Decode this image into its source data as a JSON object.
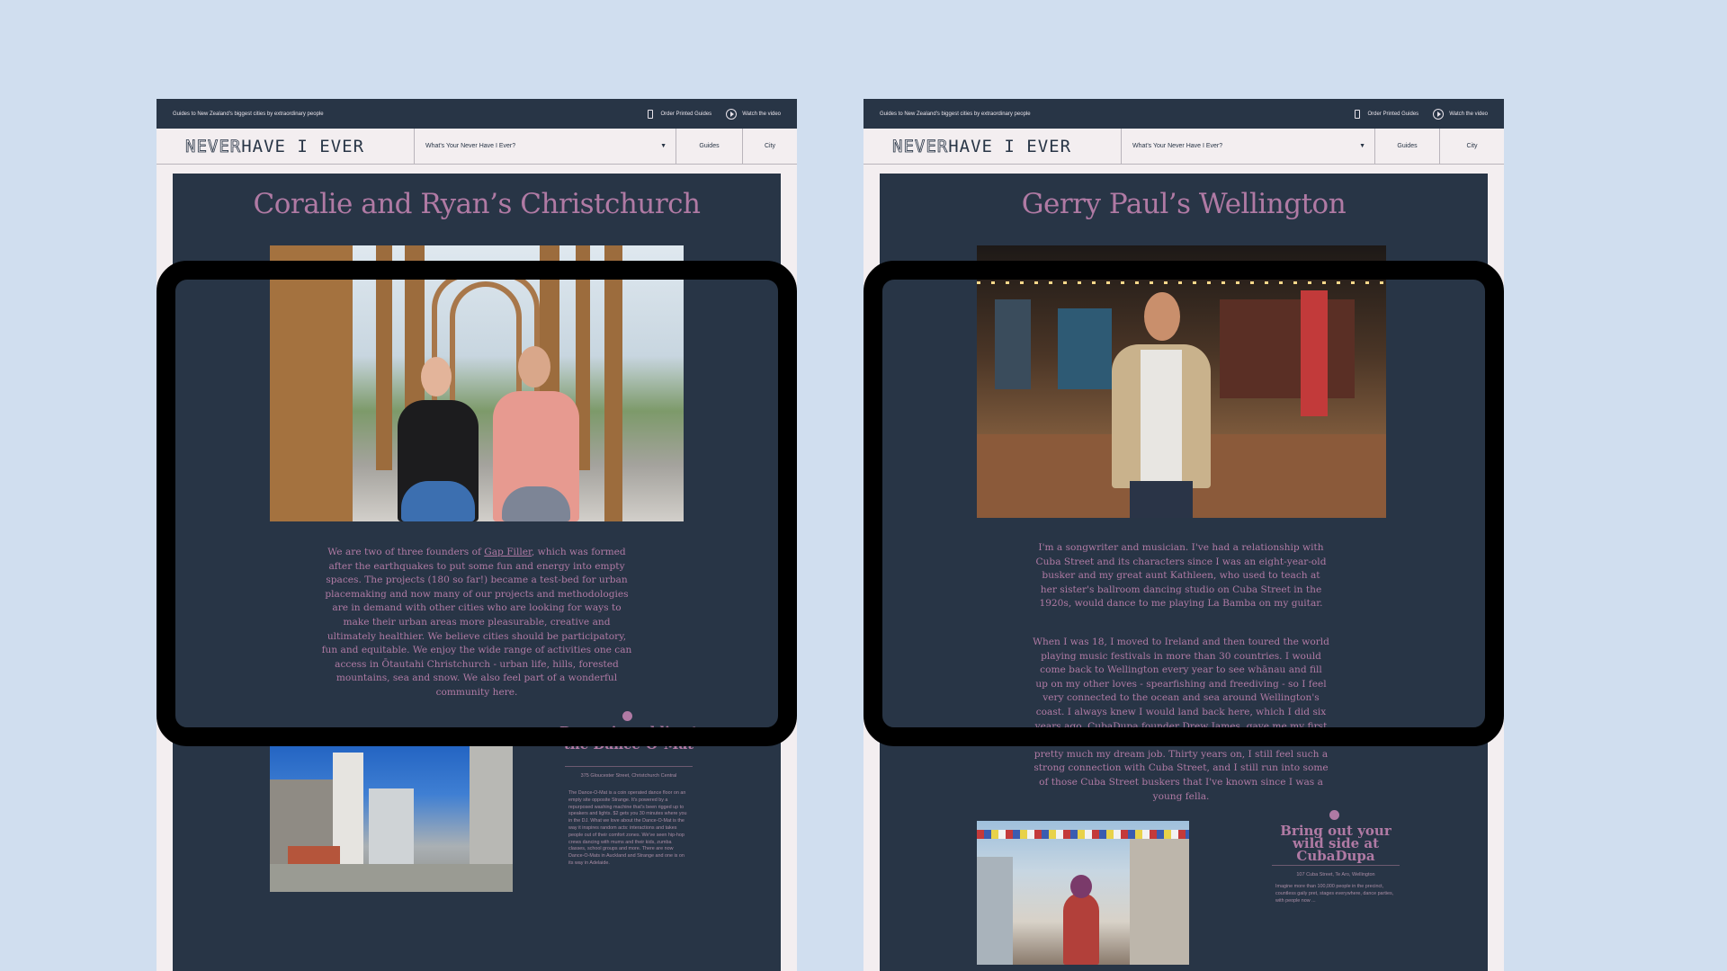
{
  "left": {
    "topbar": {
      "tagline": "Guides to New Zealand's biggest cities by extraordinary people",
      "order_label": "Order Printed Guides",
      "video_label": "Watch the video"
    },
    "nav": {
      "logo_never": "NEVER",
      "logo_rest": "HAVE I EVER",
      "select_label": "What's Your Never Have I Ever?",
      "guides_label": "Guides",
      "city_label": "City"
    },
    "title": "Coralie and Ryan’s Christchurch",
    "body_before_link": "We are two of three founders of ",
    "body_link": "Gap Filler",
    "body_after_link": ", which was formed after the earthquakes to put some fun and energy into empty spaces. The projects (180 so far!) became a test-bed for urban placemaking and now many of our projects and methodologies are in demand with other cities who are looking for ways to make their urban areas more pleasurable, creative and ultimately healthier. We believe cities should be participatory, fun and equitable. We enjoy the wide range of activities one can access in Ōtautahi Christchurch - urban life, hills, forested mountains, sea and snow. We also feel part of a wonderful community here.",
    "section": {
      "title": "Dance in public at the Dance-O-Mat",
      "address": "375 Gloucester Street, Christchurch Central",
      "text": "The Dance-O-Mat is a coin operated dance floor on an empty site opposite Strange. It's powered by a repurposed washing machine that's been rigged up to speakers and lights. $2 gets you 30 minutes where you in the DJ. What we love about the Dance-O-Mat is the way it inspires random acts: interactions and takes people out of their comfort zones. We've seen hip-hop crews dancing with mums and their kids, zumba classes, school groups and more. There are now Dance-O-Mats in Auckland and Strange and one is on its way in Adelaide."
    }
  },
  "right": {
    "topbar": {
      "tagline": "Guides to New Zealand's biggest cities by extraordinary people",
      "order_label": "Order Printed Guides",
      "video_label": "Watch the video"
    },
    "nav": {
      "logo_never": "NEVER",
      "logo_rest": "HAVE I EVER",
      "select_label": "What's Your Never Have I Ever?",
      "guides_label": "Guides",
      "city_label": "City"
    },
    "title": "Gerry Paul’s Wellington",
    "p1": "I'm a songwriter and musician. I've had a relationship with Cuba Street and its characters since I was an eight-year-old busker and my great aunt Kathleen, who used to teach at her sister's ballroom dancing studio on Cuba Street in the 1920s, would dance to me playing La Bamba on my guitar.",
    "p2_before_link": "When I was 18, I moved to Ireland and then toured the world playing music festivals in more than 30 countries. I would come back to Wellington every year to see whānau and fill up on my other loves - spearfishing and freediving - so I feel very connected to the ocean and sea around Wellington's coast. I always knew I would land back here, which I did six years ago. ",
    "p2_link": "CubaDupa",
    "p2_after_link": " founder Drew James, gave me my first “real job” as the music co-ordinator for the festival, which is pretty much my dream job. Thirty years on, I still feel such a strong connection with Cuba Street, and I still run into some of those Cuba Street buskers that I've known since I was a young fella.",
    "section": {
      "title": "Bring out your wild side at CubaDupa",
      "address": "107 Cuba Street, Te Aro, Wellington",
      "text": "Imagine more than 100,000 people in the precinct, countless gaily pret, stages everywhere, dance parties, with people now ..."
    }
  }
}
